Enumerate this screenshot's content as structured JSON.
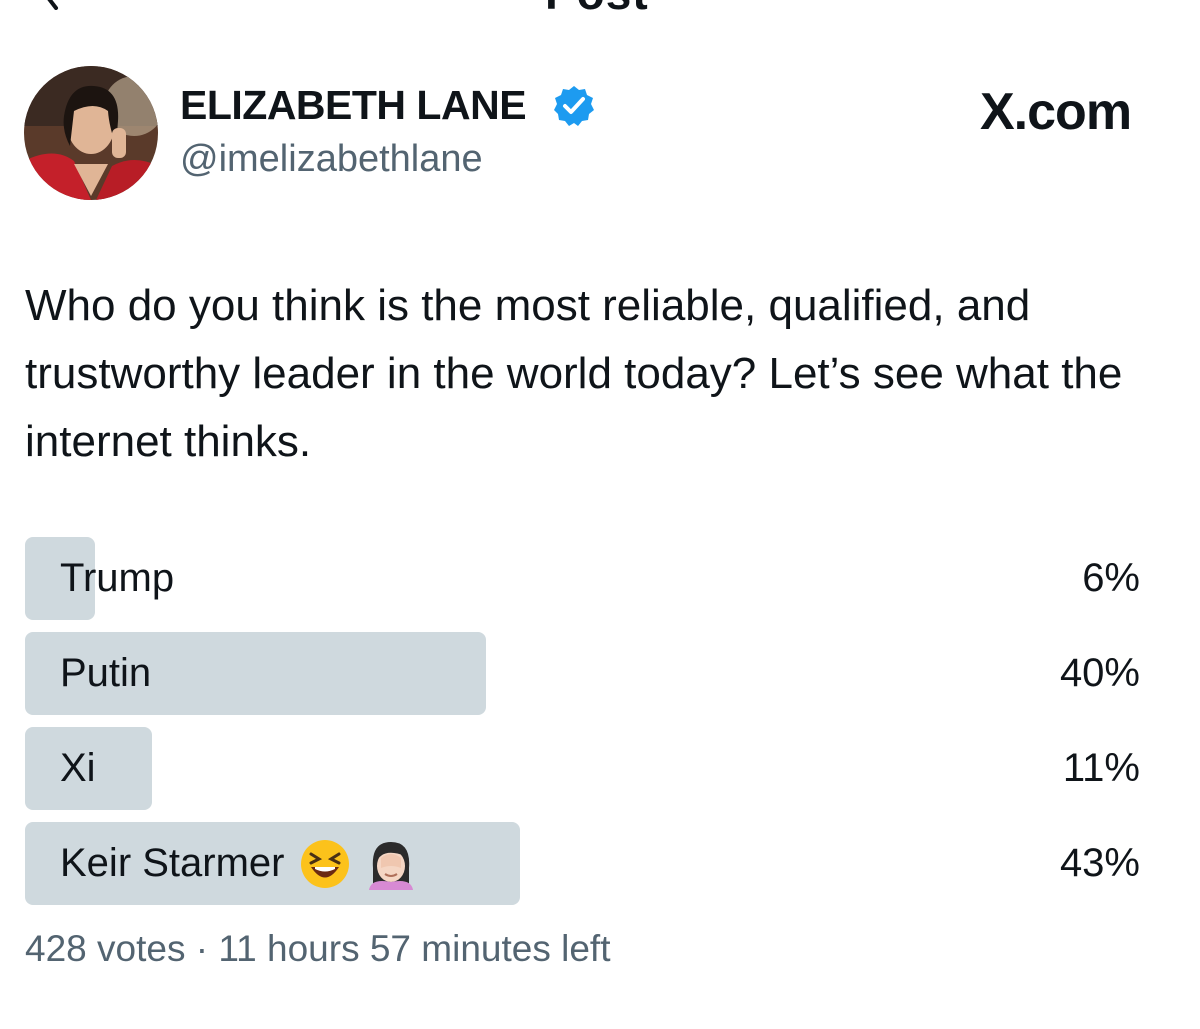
{
  "header": {
    "title": "Post"
  },
  "author": {
    "display_name": "ELIZABETH LANE",
    "handle": "@imelizabethlane",
    "verified": true
  },
  "brand": {
    "label": "X.com"
  },
  "post": {
    "text": "Who do you think is the most reliable, qualified, and trustworthy leader in the world today? Let’s see what the internet thinks."
  },
  "poll": {
    "options": [
      {
        "label": "Trump",
        "percent_text": "6%",
        "percent": 6
      },
      {
        "label": "Putin",
        "percent_text": "40%",
        "percent": 40
      },
      {
        "label": "Xi",
        "percent_text": "11%",
        "percent": 11
      },
      {
        "label": "Keir Starmer",
        "percent_text": "43%",
        "percent": 43,
        "emojis": [
          "laughing-face-emoji",
          "woman-facepalming-emoji"
        ]
      }
    ],
    "footer": "428 votes · 11 hours 57 minutes left"
  },
  "colors": {
    "poll_bar": "#cfd9de",
    "secondary_text": "#536471",
    "verified": "#1d9bf0"
  }
}
